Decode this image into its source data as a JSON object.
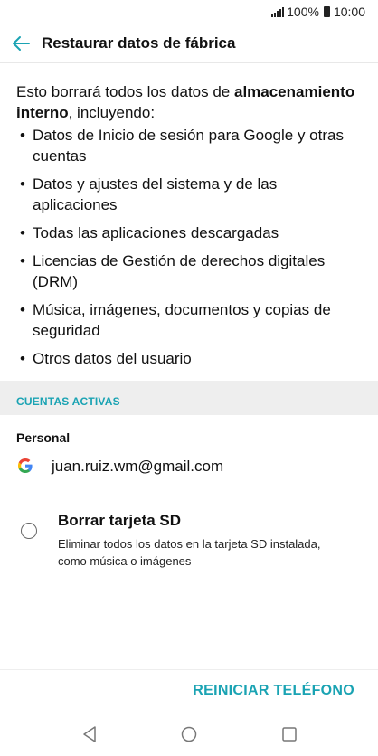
{
  "status_bar": {
    "signal_icon": "signal-bars-icon",
    "battery_percent": "100%",
    "battery_icon": "battery-icon",
    "time": "10:00"
  },
  "app_bar": {
    "back_icon": "arrow-left-icon",
    "title": "Restaurar datos de fábrica"
  },
  "warning": {
    "prefix": "Esto borrará todos los datos de ",
    "emphasis": "almacenamiento interno",
    "suffix": ", incluyendo:"
  },
  "items": [
    "Datos de Inicio de sesión para Google y otras cuentas",
    "Datos y ajustes del sistema y de las aplicaciones",
    "Todas las aplicaciones descargadas",
    "Licencias de Gestión de derechos digitales (DRM)",
    "Música, imágenes, documentos y copias de seguridad",
    "Otros datos del usuario"
  ],
  "accounts": {
    "section_label": "CUENTAS ACTIVAS",
    "group_label": "Personal",
    "account_icon": "google-icon",
    "email": "juan.ruiz.wm@gmail.com"
  },
  "sd_option": {
    "title": "Borrar tarjeta SD",
    "description": "Eliminar todos los datos en la tarjeta SD instalada, como música o imágenes",
    "checked": false
  },
  "action": {
    "reset_label": "REINICIAR TELÉFONO"
  },
  "nav": {
    "back_icon": "triangle-back-icon",
    "home_icon": "circle-home-icon",
    "recents_icon": "square-recents-icon"
  },
  "colors": {
    "accent": "#1aa3b3",
    "section_bg": "#eeeeee"
  }
}
